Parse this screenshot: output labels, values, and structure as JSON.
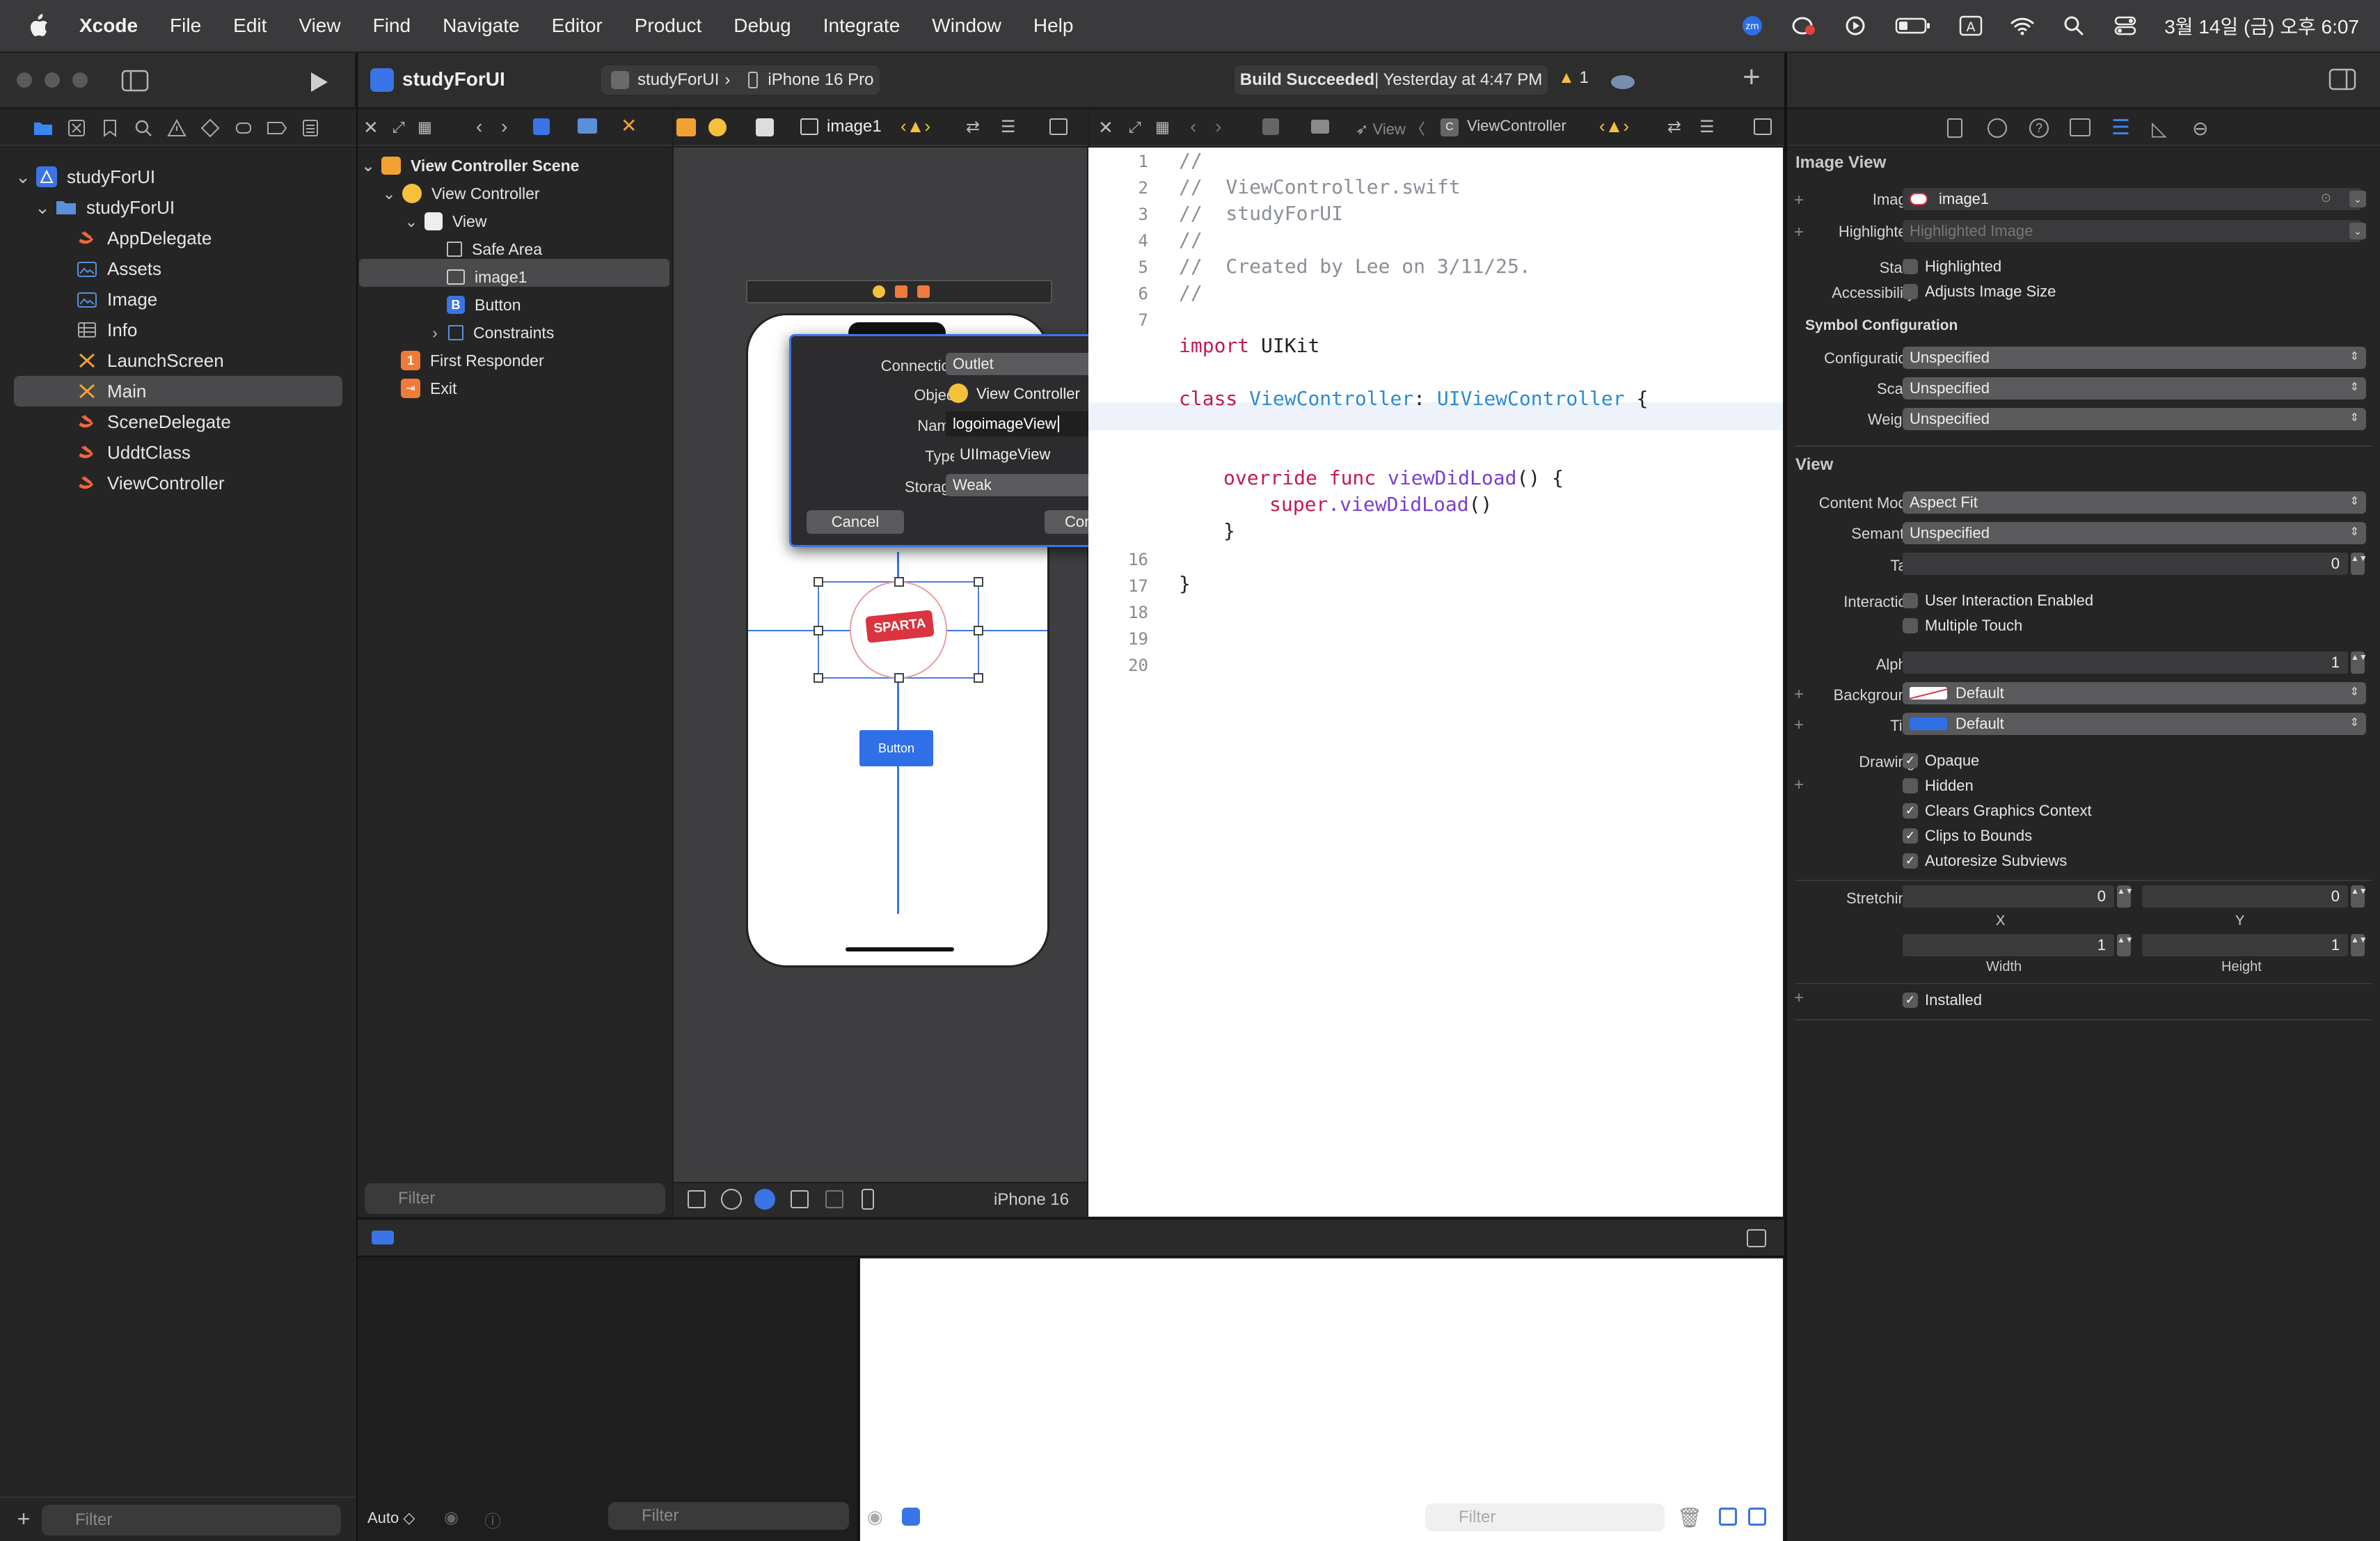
{
  "menubar": {
    "items": [
      "Xcode",
      "File",
      "Edit",
      "View",
      "Find",
      "Navigate",
      "Editor",
      "Product",
      "Debug",
      "Integrate",
      "Window",
      "Help"
    ],
    "clock": "3월 14일 (금) 오후 6:07"
  },
  "toolbar": {
    "project": "studyForUI",
    "scheme": "studyForUI",
    "device": "iPhone 16 Pro",
    "status_bold": "Build Succeeded",
    "status_rest": " | Yesterday at 4:47 PM",
    "warnings": "1"
  },
  "navigator": {
    "root": "studyForUI",
    "group": "studyForUI",
    "files": [
      "AppDelegate",
      "Assets",
      "Image",
      "Info",
      "LaunchScreen",
      "Main",
      "SceneDelegate",
      "UddtClass",
      "ViewController"
    ],
    "filter_placeholder": "Filter"
  },
  "outline": {
    "scene": "View Controller Scene",
    "vc": "View Controller",
    "view": "View",
    "safe_area": "Safe Area",
    "image": "image1",
    "button": "Button",
    "constraints": "Constraints",
    "first_responder": "First Responder",
    "exit": "Exit",
    "filter_placeholder": "Filter"
  },
  "ib_jumpbar": {
    "current": "image1"
  },
  "canvas": {
    "device_label": "iPhone 16",
    "logo_text": "SPARTA",
    "button_label": "Button"
  },
  "connection_popup": {
    "connection_label": "Connection",
    "connection_value": "Outlet",
    "object_label": "Object",
    "object_value": "View Controller",
    "name_label": "Name",
    "name_value": "logoimageView",
    "type_label": "Type",
    "type_value": "UIImageView",
    "storage_label": "Storage",
    "storage_value": "Weak",
    "cancel": "Cancel",
    "connect": "Connect"
  },
  "editor": {
    "jumpbar": {
      "folder": "View",
      "file": "ViewController"
    },
    "line_numbers": [
      "1",
      "2",
      "3",
      "4",
      "5",
      "6",
      "7",
      "16",
      "17",
      "18",
      "19",
      "20"
    ],
    "lines": {
      "l1": "//",
      "l2": "//  ViewController.swift",
      "l3": "//  studyForUI",
      "l4": "//",
      "l5": "//  Created by Lee on 3/11/25.",
      "l6": "//",
      "import_kw": "import",
      "import_mod": " UIKit",
      "class_kw": "class",
      "class_name": " ViewController",
      "colon": ": ",
      "superclass": "UIViewController",
      "brace_open": " {",
      "override_kw": "override",
      "func_kw": " func",
      "method": " viewDidLoad",
      "method_rest": "() {",
      "super_kw": "super",
      "super_call": ".viewDidLoad",
      "super_rest": "()",
      "close_inner": "}",
      "close_outer": "}"
    }
  },
  "debug": {
    "auto_label": "Auto ◇",
    "filter_placeholder": "Filter"
  },
  "inspector": {
    "image_view_title": "Image View",
    "image_label": "Image",
    "image_value": "image1",
    "highlighted_label": "Highlighted",
    "highlighted_placeholder": "Highlighted Image",
    "state_label": "State",
    "state_option": "Highlighted",
    "accessibility_label": "Accessibility",
    "accessibility_option": "Adjusts Image Size",
    "symbol_config_title": "Symbol Configuration",
    "configuration_label": "Configuration",
    "configuration_value": "Unspecified",
    "scale_label": "Scale",
    "scale_value": "Unspecified",
    "weight_label": "Weight",
    "weight_value": "Unspecified",
    "view_title": "View",
    "content_mode_label": "Content Mode",
    "content_mode_value": "Aspect Fit",
    "semantic_label": "Semantic",
    "semantic_value": "Unspecified",
    "tag_label": "Tag",
    "tag_value": "0",
    "interaction_label": "Interaction",
    "interaction_opt1": "User Interaction Enabled",
    "interaction_opt2": "Multiple Touch",
    "alpha_label": "Alpha",
    "alpha_value": "1",
    "background_label": "Background",
    "background_value": "Default",
    "tint_label": "Tint",
    "tint_value": "Default",
    "drawing_label": "Drawing",
    "drawing_opts": [
      "Opaque",
      "Hidden",
      "Clears Graphics Context",
      "Clips to Bounds",
      "Autoresize Subviews"
    ],
    "stretching_label": "Stretching",
    "stretch_x": "0",
    "stretch_y": "0",
    "stretch_w": "1",
    "stretch_h": "1",
    "x_label": "X",
    "y_label": "Y",
    "width_label": "Width",
    "height_label": "Height",
    "installed_label": "Installed"
  }
}
